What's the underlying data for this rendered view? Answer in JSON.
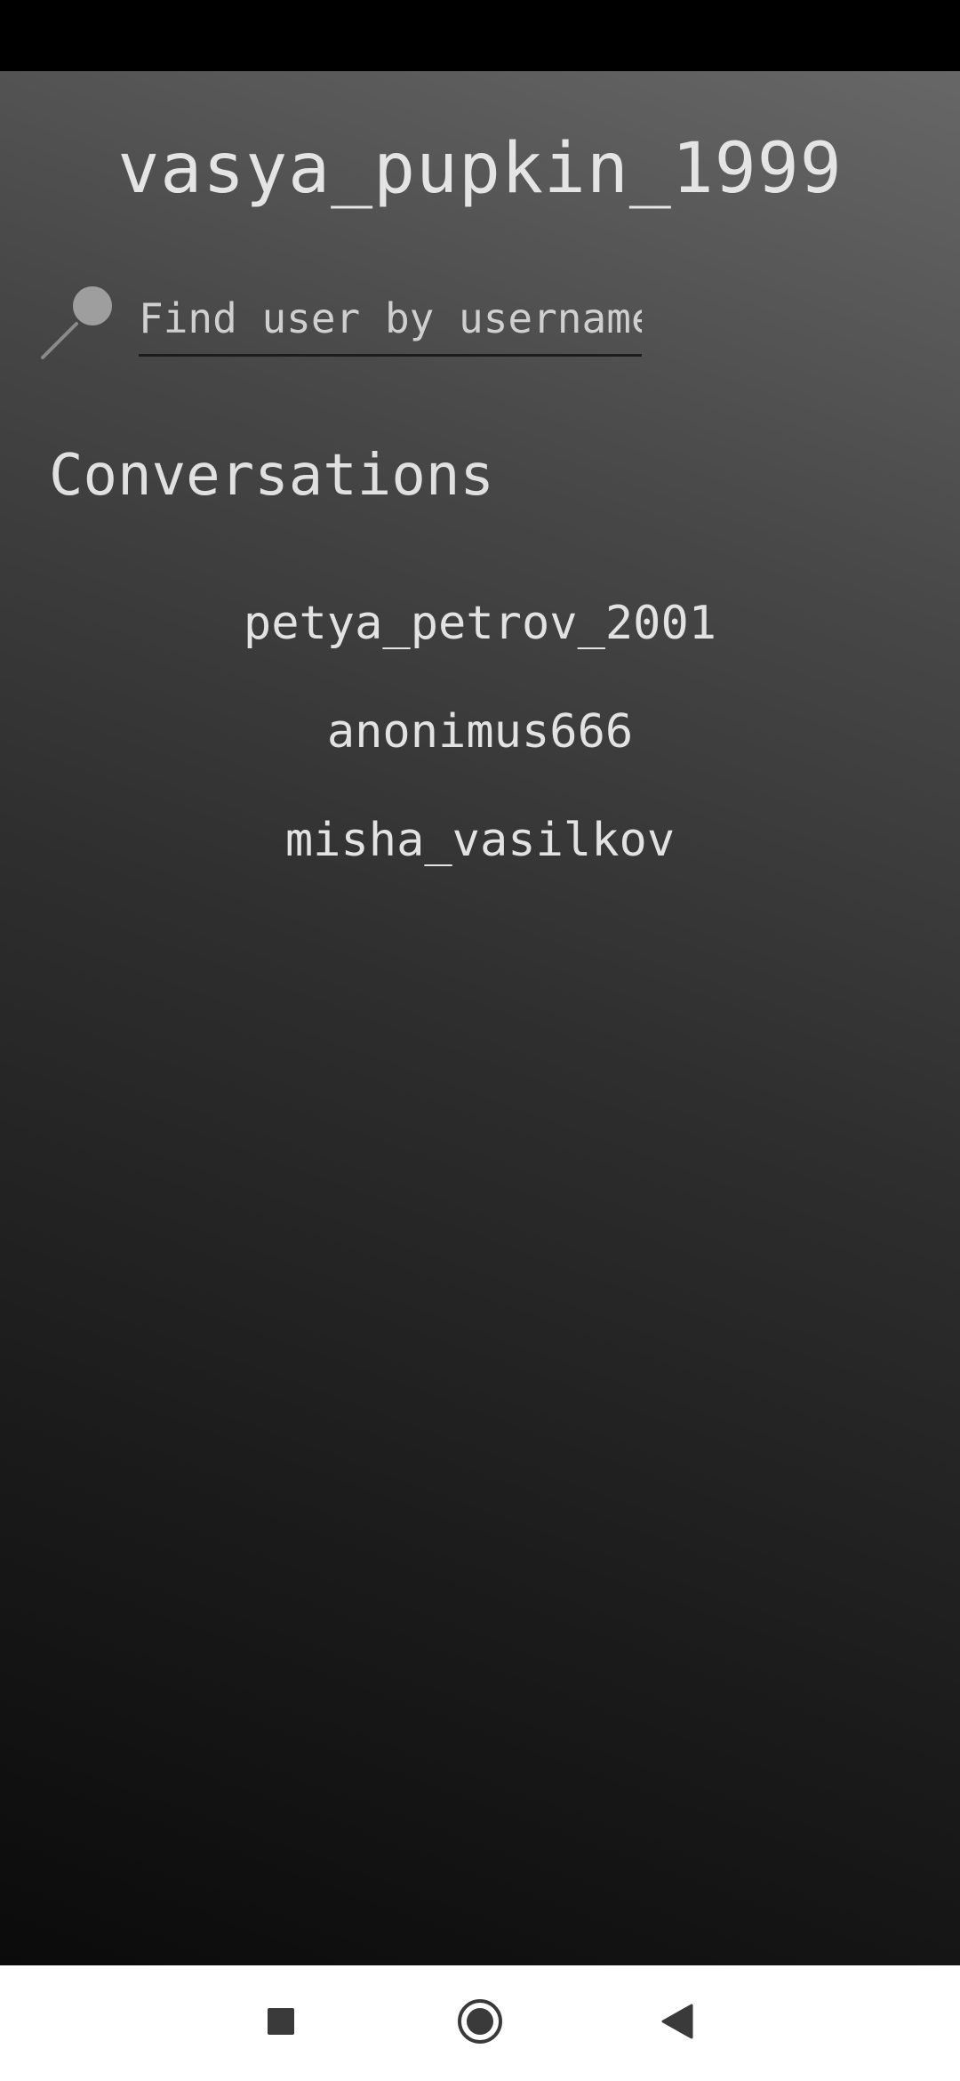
{
  "profile": {
    "username": "vasya_pupkin_1999"
  },
  "search": {
    "placeholder": "Find user by username",
    "icon": "magnifier-icon"
  },
  "conversations": {
    "title": "Conversations",
    "items": [
      {
        "label": "petya_petrov_2001"
      },
      {
        "label": "anonimus666"
      },
      {
        "label": "misha_vasilkov"
      }
    ]
  },
  "nav": {
    "buttons": [
      {
        "icon": "recents-square-icon"
      },
      {
        "icon": "home-circle-icon"
      },
      {
        "icon": "back-triangle-icon"
      }
    ]
  },
  "colors": {
    "status_bar": "#000000",
    "nav_bar": "#ffffff",
    "text_primary": "#e4e4e4",
    "nav_icon": "#3a3a3a"
  }
}
